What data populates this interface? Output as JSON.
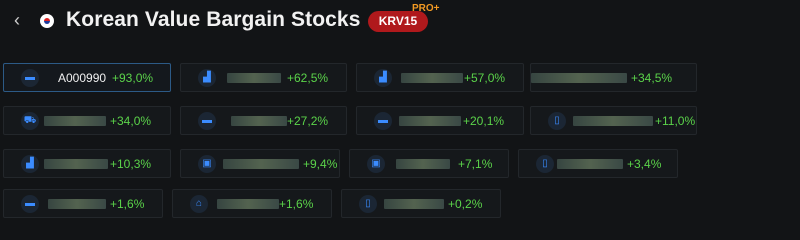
{
  "header": {
    "title": "Korean Value Bargain Stocks",
    "badge": "KRV15",
    "badge_tag": "PRO+",
    "back_icon": "chevron-left-icon",
    "flag_icon": "korea-flag-icon"
  },
  "colors": {
    "positive": "#5bd34a",
    "badge": "#b0191c",
    "pro": "#f29a23",
    "icon": "#3b8cff"
  },
  "stocks": [
    {
      "code": "A000990",
      "change": "+93,0%",
      "icon": "monitor-icon",
      "selected": true
    },
    {
      "code": "",
      "change": "+62,5%",
      "icon": "factory-icon"
    },
    {
      "code": "",
      "change": "+57,0%",
      "icon": "factory-icon"
    },
    {
      "code": "",
      "change": "+34,5%",
      "icon": ""
    },
    {
      "code": "",
      "change": "+34,0%",
      "icon": "cart-icon"
    },
    {
      "code": "",
      "change": "+27,2%",
      "icon": "monitor-icon"
    },
    {
      "code": "",
      "change": "+20,1%",
      "icon": "monitor-icon"
    },
    {
      "code": "",
      "change": "+11,0%",
      "icon": "phone-icon"
    },
    {
      "code": "",
      "change": "+10,3%",
      "icon": "factory-icon"
    },
    {
      "code": "",
      "change": "+9,4%",
      "icon": "bag-icon"
    },
    {
      "code": "",
      "change": "+7,1%",
      "icon": "bag-icon"
    },
    {
      "code": "",
      "change": "+3,4%",
      "icon": "phone-icon"
    },
    {
      "code": "",
      "change": "+1,6%",
      "icon": "monitor-icon"
    },
    {
      "code": "",
      "change": "+1,6%",
      "icon": "bank-icon"
    },
    {
      "code": "",
      "change": "+0,2%",
      "icon": "phone-icon"
    }
  ]
}
